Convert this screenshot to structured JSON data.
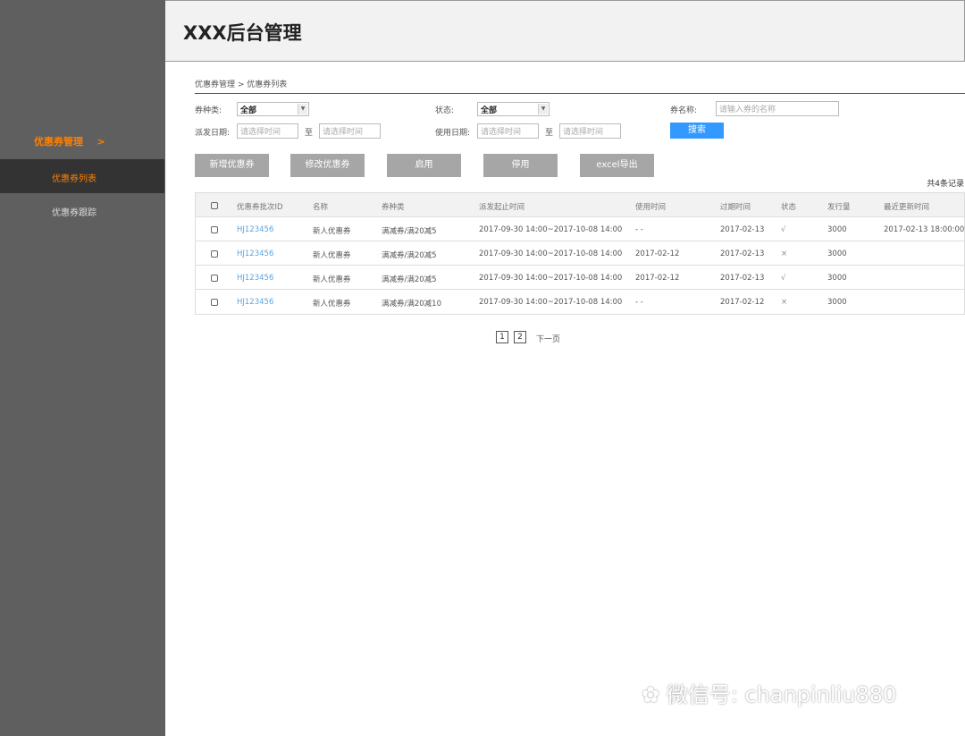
{
  "app": {
    "title": "XXX后台管理"
  },
  "sidebar": {
    "group": "优惠券管理",
    "group_arrow": ">",
    "items": [
      {
        "label": "优惠券列表",
        "active": true
      },
      {
        "label": "优惠券跟踪",
        "active": false
      }
    ]
  },
  "breadcrumb": "优惠券管理 > 优惠券列表",
  "filters": {
    "type_label": "券种类:",
    "type_value": "全部",
    "status_label": "状态:",
    "status_value": "全部",
    "name_label": "券名称:",
    "name_placeholder": "请输入券的名称",
    "issue_date_label": "派发日期:",
    "use_date_label": "使用日期:",
    "date_placeholder": "请选择时间",
    "to": "至",
    "search": "搜索"
  },
  "actions": [
    "新增优惠券",
    "修改优惠券",
    "启用",
    "停用",
    "excel导出"
  ],
  "record_count": "共4条记录",
  "table": {
    "headers": [
      "优惠券批次ID",
      "名称",
      "券种类",
      "派发起止时间",
      "使用时间",
      "过期时间",
      "状态",
      "发行量",
      "最近更新时间"
    ],
    "rows": [
      [
        "HJ123456",
        "新人优惠券",
        "满减券/满20减5",
        "2017-09-30  14:00~2017-10-08  14:00",
        "- -",
        "2017-02-13",
        "√",
        "3000",
        "2017-02-13 18:00:00"
      ],
      [
        "HJ123456",
        "新人优惠券",
        "满减券/满20减5",
        "2017-09-30  14:00~2017-10-08  14:00",
        "2017-02-12",
        "2017-02-13",
        "×",
        "3000",
        ""
      ],
      [
        "HJ123456",
        "新人优惠券",
        "满减券/满20减5",
        "2017-09-30  14:00~2017-10-08  14:00",
        "2017-02-12",
        "2017-02-13",
        "√",
        "3000",
        ""
      ],
      [
        "HJ123456",
        "新人优惠券",
        "满减券/满20减10",
        "2017-09-30  14:00~2017-10-08  14:00",
        "- -",
        "2017-02-12",
        "×",
        "3000",
        ""
      ]
    ]
  },
  "pagination": {
    "pages": [
      "1",
      "2"
    ],
    "next": "下一页"
  },
  "watermark": "微信号: chanpinliu880",
  "colors": {
    "accent": "#ff7f00",
    "primary": "#3399ff",
    "link": "#5ba4e0",
    "sidebar": "#5f5f5f"
  }
}
